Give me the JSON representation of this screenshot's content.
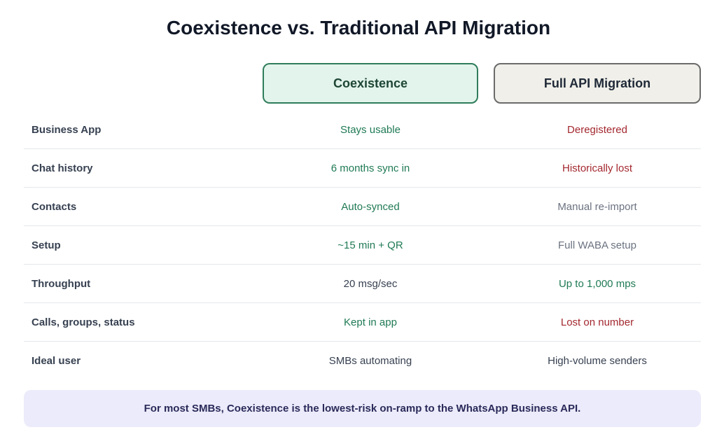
{
  "title": "Coexistence vs. Traditional API Migration",
  "columns": {
    "coexistence": "Coexistence",
    "full_api": "Full API Migration"
  },
  "rows": [
    {
      "feature": "Business App",
      "coexistence": "Stays usable",
      "coex_tone": "good",
      "full_api": "Deregistered",
      "api_tone": "bad"
    },
    {
      "feature": "Chat history",
      "coexistence": "6 months sync in",
      "coex_tone": "good",
      "full_api": "Historically lost",
      "api_tone": "bad"
    },
    {
      "feature": "Contacts",
      "coexistence": "Auto-synced",
      "coex_tone": "good",
      "full_api": "Manual re-import",
      "api_tone": "neutral"
    },
    {
      "feature": "Setup",
      "coexistence": "~15 min + QR",
      "coex_tone": "good",
      "full_api": "Full WABA setup",
      "api_tone": "neutral"
    },
    {
      "feature": "Throughput",
      "coexistence": "20 msg/sec",
      "coex_tone": "plain",
      "full_api": "Up to 1,000 mps",
      "api_tone": "good"
    },
    {
      "feature": "Calls, groups, status",
      "coexistence": "Kept in app",
      "coex_tone": "good",
      "full_api": "Lost on number",
      "api_tone": "bad"
    },
    {
      "feature": "Ideal user",
      "coexistence": "SMBs automating",
      "coex_tone": "plain",
      "full_api": "High-volume senders",
      "api_tone": "plain"
    }
  ],
  "footer": "For most SMBs, Coexistence is the lowest-risk on-ramp to the WhatsApp Business API.",
  "colors": {
    "good": "#1f7a55",
    "bad": "#a3282f",
    "neutral": "#6b7280",
    "coex_accent": "#2f7d5b",
    "footer_bg": "#ecebfb"
  }
}
